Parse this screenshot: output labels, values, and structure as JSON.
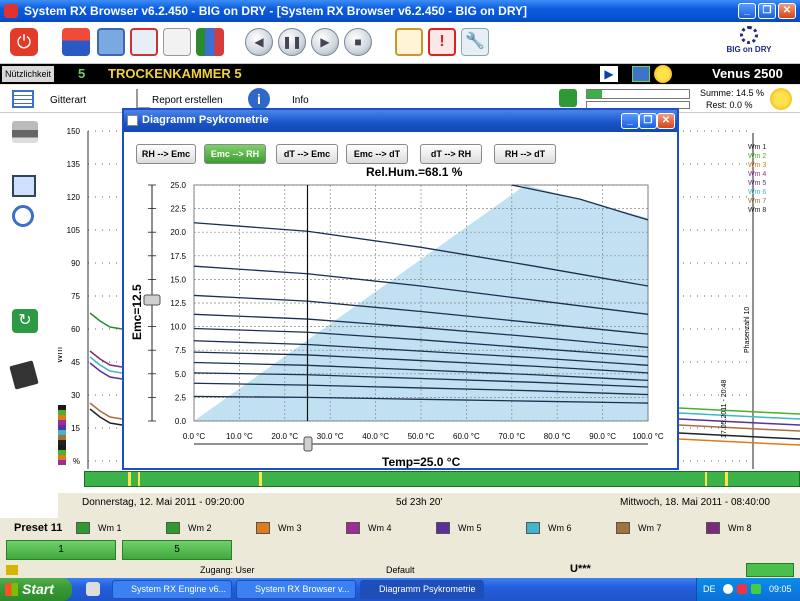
{
  "window": {
    "title": "System RX Browser v6.2.450 - BIG on DRY - [System RX Browser v6.2.450 - BIG on DRY]"
  },
  "brand": {
    "logo_text": "BIG on DRY"
  },
  "status": {
    "nutz_label": "Nützlichkeit",
    "chamber_no": "5",
    "chamber_name": "TROCKENKAMMER 5",
    "device": "Venus 2500"
  },
  "infobar": {
    "gitterart": "Gitterart",
    "report": "Report erstellen",
    "info": "Info",
    "summe": "Summe: 14.5 %",
    "rest": "Rest: 0.0 %"
  },
  "plot": {
    "y_ticks": [
      "150",
      "135",
      "120",
      "105",
      "90",
      "75",
      "60",
      "45",
      "30",
      "15",
      "%"
    ],
    "y_label": "Wm",
    "legend": [
      "Wm 1",
      "Wm 2",
      "Wm 3",
      "Wm 4",
      "Wm 5",
      "Wm 6",
      "Wm 7",
      "Wm 8"
    ],
    "legend_colors": [
      "#1a1a1a",
      "#4caf2e",
      "#e07b1a",
      "#9b2d9b",
      "#5b2f9e",
      "#3fb6cc",
      "#a4703c",
      "#222222"
    ],
    "vert_label": "Phasenzahl 10",
    "vert_label2": "17.05.2011 - 20:48",
    "start": "Donnerstag, 12. Mai 2011  -  09:20:00",
    "duration": "5d 23h 20'",
    "end": "Mittwoch, 18. Mai 2011  -  08:40:00"
  },
  "dialog": {
    "title": "Diagramm Psykrometrie",
    "modes": [
      "RH --> Emc",
      "Emc --> RH",
      "dT --> Emc",
      "Emc --> dT",
      "dT --> RH",
      "RH --> dT"
    ],
    "active_mode": 1,
    "rel_hum": "Rel.Hum.=68.1 %",
    "emc": "Emc=12.5",
    "temp": "Temp=25.0 °C"
  },
  "chart_data": {
    "type": "line",
    "title": "Rel.Hum.=68.1 %",
    "xlabel": "Temp=25.0 °C",
    "ylabel": "Emc=12.5",
    "x_ticks": [
      "0.0 °C",
      "10.0 °C",
      "20.0 °C",
      "30.0 °C",
      "40.0 °C",
      "50.0 °C",
      "60.0 °C",
      "70.0 °C",
      "80.0 °C",
      "90.0 °C",
      "100.0 °C"
    ],
    "y_ticks": [
      "0.0",
      "2.5",
      "5.0",
      "7.5",
      "10.0",
      "12.5",
      "15.0",
      "17.5",
      "20.0",
      "22.5",
      "25.0"
    ],
    "xlim": [
      0,
      100
    ],
    "ylim": [
      0,
      25
    ],
    "grid": true,
    "cursor_x": 25,
    "series": [
      {
        "x": [
          0,
          25,
          50,
          75,
          100
        ],
        "y": [
          2.6,
          2.5,
          2.3,
          2.1,
          1.9
        ]
      },
      {
        "x": [
          0,
          25,
          50,
          75,
          100
        ],
        "y": [
          4.0,
          3.8,
          3.5,
          3.2,
          2.8
        ]
      },
      {
        "x": [
          0,
          25,
          50,
          75,
          100
        ],
        "y": [
          5.1,
          4.9,
          4.5,
          4.1,
          3.6
        ]
      },
      {
        "x": [
          0,
          25,
          50,
          75,
          100
        ],
        "y": [
          6.2,
          5.9,
          5.4,
          4.9,
          4.3
        ]
      },
      {
        "x": [
          0,
          25,
          50,
          75,
          100
        ],
        "y": [
          7.3,
          7.0,
          6.4,
          5.8,
          5.1
        ]
      },
      {
        "x": [
          0,
          25,
          50,
          75,
          100
        ],
        "y": [
          8.5,
          8.1,
          7.4,
          6.7,
          5.9
        ]
      },
      {
        "x": [
          0,
          25,
          50,
          75,
          100
        ],
        "y": [
          9.8,
          9.4,
          8.6,
          7.7,
          6.8
        ]
      },
      {
        "x": [
          0,
          25,
          50,
          75,
          100
        ],
        "y": [
          11.3,
          10.8,
          9.9,
          8.9,
          7.8
        ]
      },
      {
        "x": [
          0,
          25,
          50,
          75,
          100
        ],
        "y": [
          13.3,
          12.7,
          11.6,
          10.4,
          9.2
        ]
      },
      {
        "x": [
          0,
          25,
          50,
          75,
          100
        ],
        "y": [
          16.4,
          15.6,
          14.3,
          12.8,
          11.3
        ]
      },
      {
        "x": [
          0,
          25,
          50,
          75,
          100
        ],
        "y": [
          21.0,
          20.1,
          18.4,
          16.4,
          14.3
        ]
      },
      {
        "x": [
          70,
          85,
          100
        ],
        "y": [
          25.0,
          23.5,
          21.3
        ]
      }
    ]
  },
  "presets": {
    "label": "Preset 11",
    "buttons": [
      "1",
      "5"
    ],
    "wm": [
      "Wm 1",
      "Wm 2",
      "Wm 3",
      "Wm 4",
      "Wm 5",
      "Wm 6",
      "Wm 7",
      "Wm 8"
    ],
    "wm_colors": [
      "#2e9b2e",
      "#2e9b2e",
      "#e07b1a",
      "#9b2d9b",
      "#5b2f9e",
      "#3fb6cc",
      "#a4703c",
      "#7a2a7a"
    ]
  },
  "bottom": {
    "zugang": "Zugang: User",
    "default": "Default",
    "user": "U***"
  },
  "taskbar": {
    "start": "Start",
    "items": [
      "System RX Engine v6...",
      "System RX Browser v...",
      "Diagramm Psykrometrie"
    ],
    "lang": "DE",
    "clock": "09:05"
  }
}
